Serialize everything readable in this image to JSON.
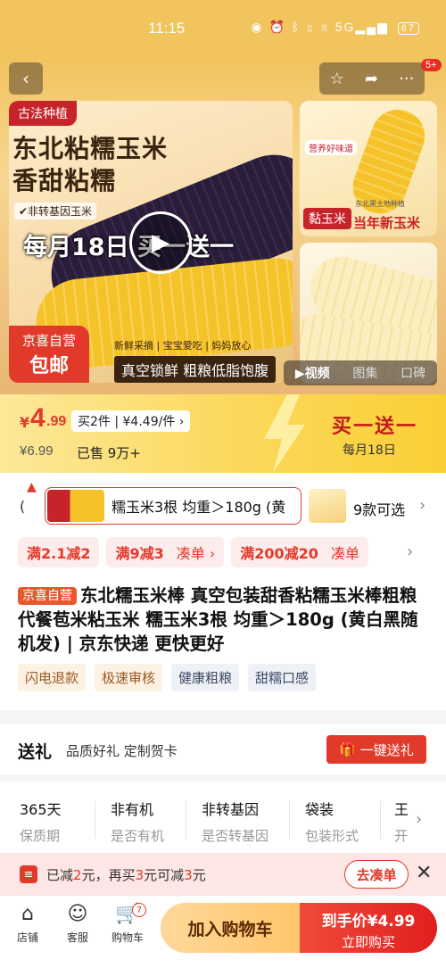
{
  "status_bar": {
    "time": "11:15",
    "battery": "67"
  },
  "header": {
    "cart_badge": "5+"
  },
  "hero": {
    "tag": "古法种植",
    "headline_1": "东北粘糯玉米",
    "headline_2": "香甜粘糯",
    "check_1": "✔非转基因玉米",
    "promo": "每月18日 买一送一",
    "self_label_1": "京喜自营",
    "self_label_2": "包邮",
    "sub_line": "新鲜采摘 | 宝宝爱吃 | 妈妈放心",
    "vacuum": "真空锁鲜 粗粮低脂饱腹",
    "side_caption": "营养好味道",
    "side_label_1": "黏玉米",
    "side_label_2": "当年新玉米",
    "side_label_3": "东北黑土地种植"
  },
  "media_tabs": [
    "视频",
    "图集",
    "口碑"
  ],
  "price": {
    "yen": "¥",
    "integer": "4",
    "decimal": ".99",
    "buy_two": "买2件 | ¥4.49/件 ›",
    "original": "¥6.99",
    "sold": "已售 9万+",
    "bogo": "买一送一",
    "bogo_date": "每月18日"
  },
  "variants": {
    "paren": "(",
    "selected": "糯玉米3根 均重＞180g (黄",
    "count": "9款可选"
  },
  "coupons": [
    {
      "main": "满2.1减2",
      "sub": ""
    },
    {
      "main": "满9减3",
      "sub": "凑单 ›"
    },
    {
      "main": "满200减20",
      "sub": "凑单"
    }
  ],
  "product": {
    "badge": "京喜自营",
    "title": "东北糯玉米棒 真空包装甜香粘糯玉米棒粗粮代餐苞米粘玉米 糯玉米3根 均重＞180g (黄白黑随机发) | 京东快递 更快更好"
  },
  "tags": [
    "闪电退款",
    "极速审核",
    "健康粗粮",
    "甜糯口感"
  ],
  "gift": {
    "title": "送礼",
    "desc": "品质好礼 定制贺卡",
    "button": "一键送礼"
  },
  "specs": [
    {
      "value": "365天",
      "key": "保质期"
    },
    {
      "value": "非有机",
      "key": "是否有机"
    },
    {
      "value": "非转基因",
      "key": "是否转基因"
    },
    {
      "value": "袋装",
      "key": "包装形式"
    },
    {
      "value": "王",
      "key": "开"
    }
  ],
  "deal_bar": {
    "p1": "已减",
    "n1": "2",
    "p2": "元，再买",
    "n2": "3",
    "p3": "元可减",
    "n3": "3",
    "p4": "元",
    "button": "去凑单"
  },
  "bottom_bar": {
    "store": "店铺",
    "service": "客服",
    "cart": "购物车",
    "cart_count": "7",
    "add_cart": "加入购物车",
    "buy_price": "到手价¥4.99",
    "buy_now": "立即购买"
  },
  "colors": {
    "accent_red": "#e23a2a",
    "price_band": "#fbd85a"
  }
}
